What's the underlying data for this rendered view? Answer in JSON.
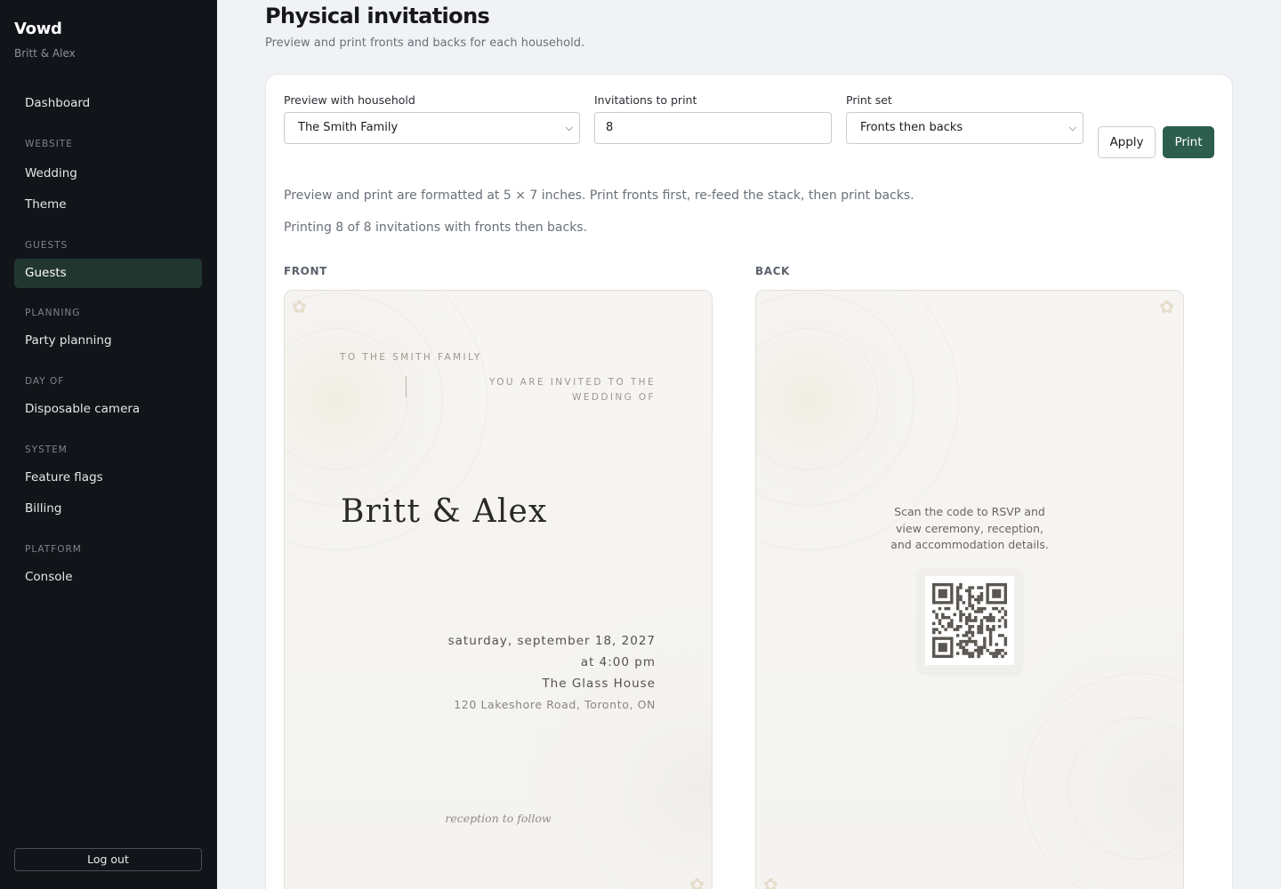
{
  "sidebar": {
    "brand": "Vowd",
    "couple": "Britt & Alex",
    "dashboard": "Dashboard",
    "sections": {
      "website": "WEBSITE",
      "guests": "GUESTS",
      "planning": "PLANNING",
      "day_of": "DAY OF",
      "system": "SYSTEM",
      "platform": "PLATFORM"
    },
    "items": {
      "wedding": "Wedding",
      "theme": "Theme",
      "guests": "Guests",
      "party_planning": "Party planning",
      "disposable_camera": "Disposable camera",
      "feature_flags": "Feature flags",
      "billing": "Billing",
      "console": "Console"
    },
    "active": "Guests",
    "logout": "Log out"
  },
  "header": {
    "title": "Physical invitations",
    "subtitle": "Preview and print fronts and backs for each household."
  },
  "controls": {
    "household_label": "Preview with household",
    "household_value": "The Smith Family",
    "count_label": "Invitations to print",
    "count_value": "8",
    "printset_label": "Print set",
    "printset_value": "Fronts then backs",
    "apply": "Apply",
    "print": "Print"
  },
  "notes": {
    "format": "Preview and print are formatted at 5 × 7 inches. Print fronts first, re-feed the stack, then print backs.",
    "status": "Printing 8 of 8 invitations with fronts then backs."
  },
  "front": {
    "label": "FRONT",
    "to": "TO THE SMITH FAMILY",
    "invited": "YOU ARE INVITED TO THE WEDDING OF",
    "names": "Britt & Alex",
    "date": "saturday, september 18, 2027",
    "time": "at 4:00 pm",
    "venue": "The Glass House",
    "address": "120 Lakeshore Road, Toronto, ON",
    "reception": "reception to follow"
  },
  "back": {
    "label": "BACK",
    "text": "Scan the code to RSVP and view ceremony, reception, and accommodation details."
  },
  "colors": {
    "sidebar_bg": "#111418",
    "active_bg": "#223630",
    "primary": "#2d5e4d",
    "page_bg": "#f1f2f5"
  }
}
